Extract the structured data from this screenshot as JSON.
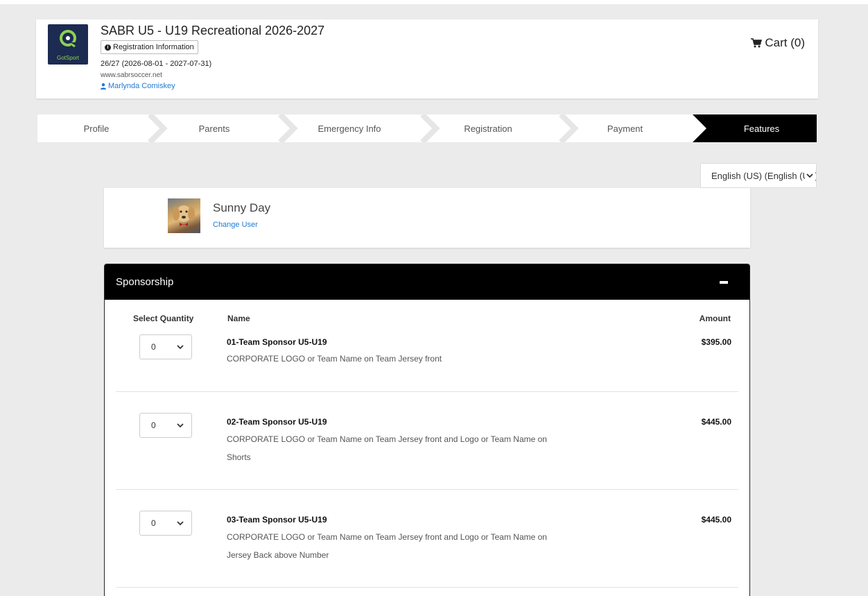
{
  "header": {
    "logo_text": "GotSport",
    "title": "SABR U5 - U19 Recreational 2026-2027",
    "reg_info_label": "Registration Information",
    "season": "26/27 (2026-08-01 - 2027-07-31)",
    "website": "www.sabrsoccer.net",
    "user": "Marlynda Comiskey",
    "cart_label": "Cart (0)"
  },
  "steps": [
    {
      "label": "Profile"
    },
    {
      "label": "Parents"
    },
    {
      "label": "Emergency Info"
    },
    {
      "label": "Registration"
    },
    {
      "label": "Payment"
    },
    {
      "label": "Features"
    }
  ],
  "language": "English (US) (English (US))",
  "participant": {
    "name": "Sunny Day",
    "change_user_label": "Change User"
  },
  "sponsorship": {
    "title": "Sponsorship",
    "columns": {
      "quantity": "Select Quantity",
      "name": "Name",
      "amount": "Amount"
    },
    "items": [
      {
        "quantity": "0",
        "name": "01-Team Sponsor U5-U19",
        "description": "CORPORATE LOGO or Team Name on Team Jersey front",
        "amount": "$395.00"
      },
      {
        "quantity": "0",
        "name": "02-Team Sponsor U5-U19",
        "description": "CORPORATE LOGO or Team Name on Team Jersey front and Logo or Team Name on Shorts",
        "amount": "$445.00"
      },
      {
        "quantity": "0",
        "name": "03-Team Sponsor U5-U19",
        "description": "CORPORATE LOGO or Team Name on Team Jersey front and Logo or Team Name on Jersey Back above Number",
        "amount": "$445.00"
      }
    ]
  },
  "colors": {
    "accent_black": "#000000",
    "link_blue": "#1f7ad1",
    "logo_bg": "#1c2b52"
  }
}
